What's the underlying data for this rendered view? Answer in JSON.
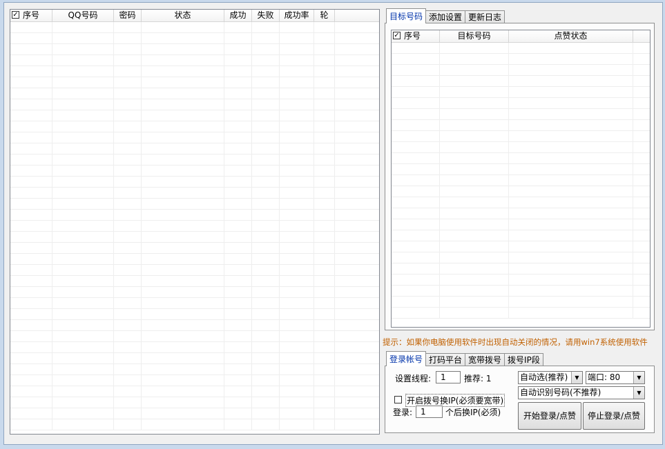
{
  "accounts_list": {
    "columns": [
      "序号",
      "QQ号码",
      "密码",
      "状态",
      "成功",
      "失败",
      "成功率",
      "轮"
    ]
  },
  "top_tabs": [
    "目标号码",
    "添加设置",
    "更新日志"
  ],
  "target_list": {
    "columns": [
      "序号",
      "目标号码",
      "点赞状态"
    ]
  },
  "tip": "提示：如果你电脑使用软件时出现自动关闭的情况，请用win7系统使用软件",
  "bottom_tabs": [
    "登录帐号",
    "打码平台",
    "宽带拨号",
    "拨号IP段"
  ],
  "settings": {
    "threads_label": "设置线程:",
    "threads_value": "1",
    "recommend_label": "推荐: 1",
    "auto_select": "自动选(推荐)",
    "port": "端口: 80",
    "recognition": "自动识别号码(不推荐)",
    "dial_ip_label": "开启拨号换IP(必须要宽带)",
    "login_label": "登录:",
    "login_value": "1",
    "login_suffix": "个后换IP(必须)",
    "start_button": "开始登录/点赞",
    "stop_button": "停止登录/点赞"
  },
  "colors": {
    "tip": "#c06000",
    "active_tab_text": "#0033aa"
  }
}
